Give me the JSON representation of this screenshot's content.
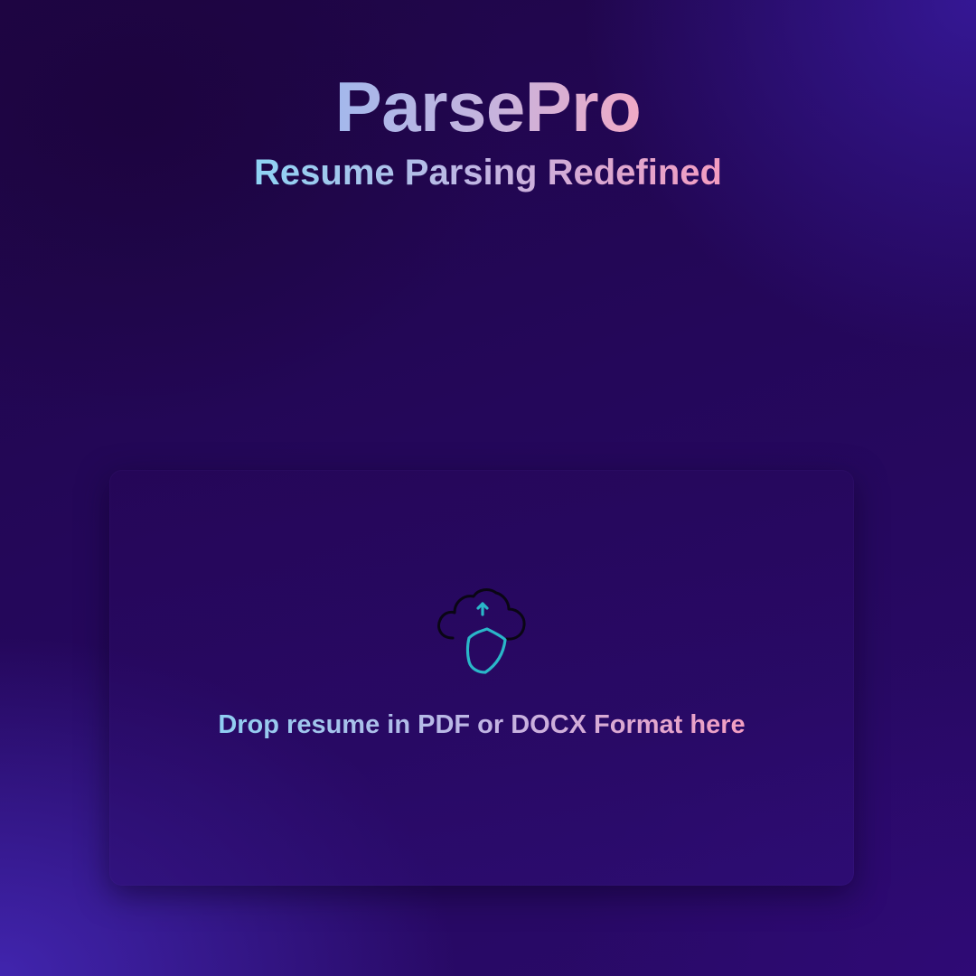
{
  "header": {
    "title": "ParsePro",
    "subtitle": "Resume Parsing Redefined"
  },
  "dropzone": {
    "icon": "cloud-upload-shield-icon",
    "label": "Drop resume in PDF or DOCX Format here"
  },
  "colors": {
    "background": "#22064f",
    "gradient_start": "#8ed3f4",
    "gradient_end": "#f49cc0",
    "icon_accent": "#2ab7c9",
    "icon_outline": "#0a0614"
  }
}
